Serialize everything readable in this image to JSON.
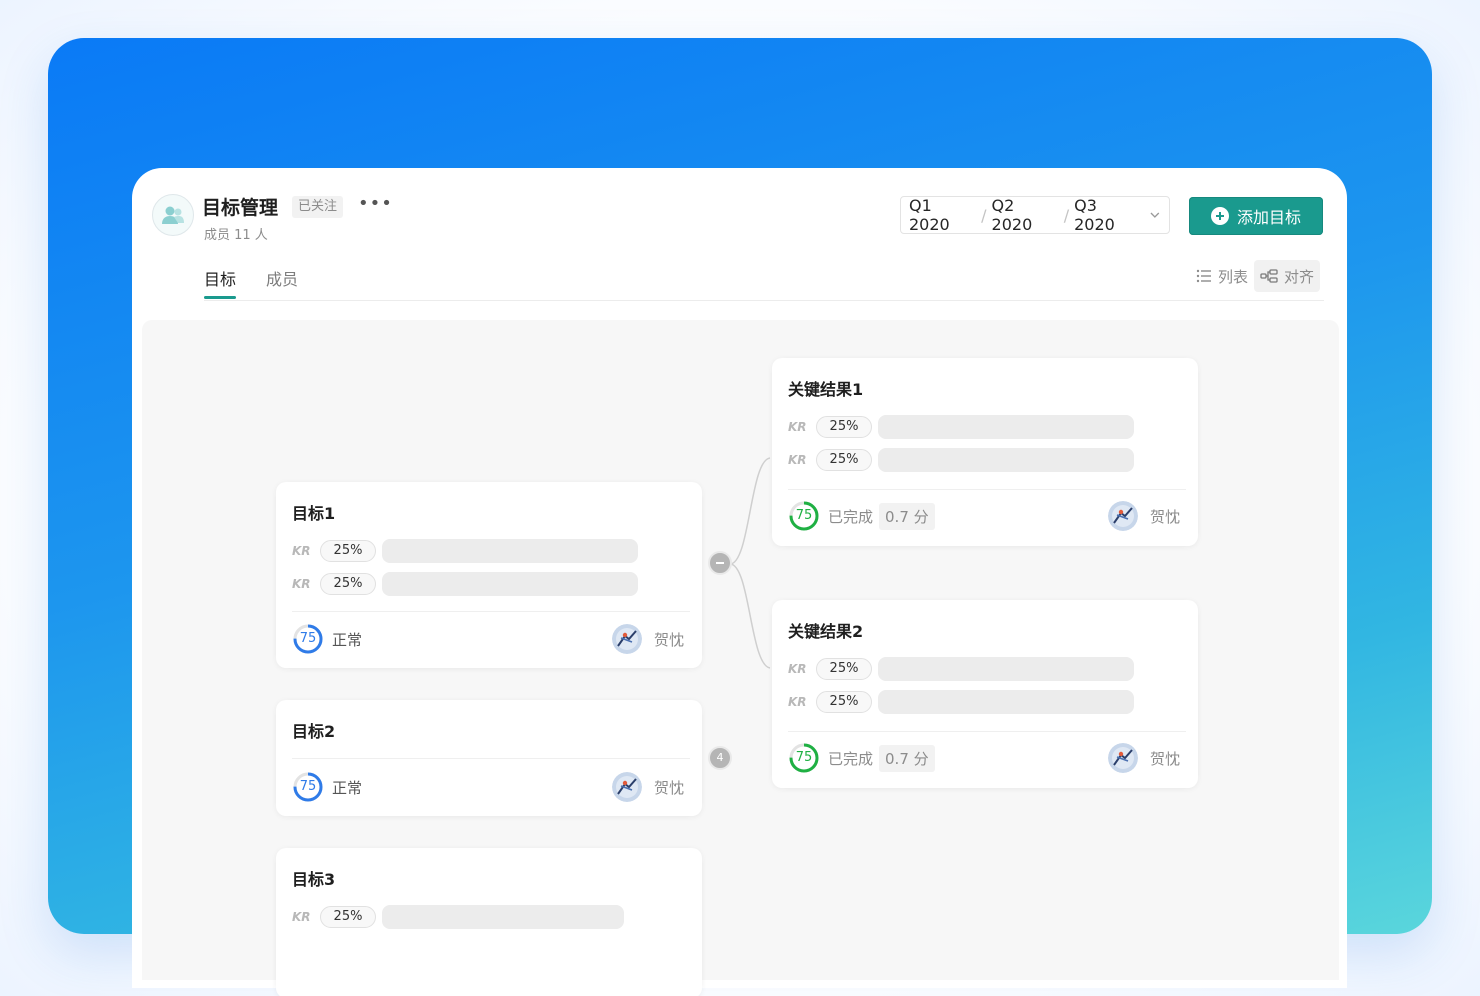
{
  "header": {
    "title": "目标管理",
    "follow_label": "已关注",
    "more_label": "•••",
    "members_label": "成员 11 人"
  },
  "quarters": [
    "Q1 2020",
    "Q2 2020",
    "Q3 2020"
  ],
  "add_button_label": "添加目标",
  "tabs": [
    {
      "label": "目标",
      "active": true
    },
    {
      "label": "成员",
      "active": false
    }
  ],
  "view_switch": {
    "list_label": "列表",
    "align_label": "对齐",
    "active": "align"
  },
  "colors": {
    "accent": "#1a9a8e",
    "score_blue": "#2f7be8",
    "score_green": "#1fb043"
  },
  "objectives": [
    {
      "title": "目标1",
      "krs": [
        {
          "tag": "KR",
          "pct": "25%"
        },
        {
          "tag": "KR",
          "pct": "25%"
        }
      ],
      "score": "75",
      "score_fraction": 0.75,
      "status": "正常",
      "owner": "贺忱"
    },
    {
      "title": "目标2",
      "krs": [],
      "score": "75",
      "score_fraction": 0.75,
      "status": "正常",
      "owner": "贺忱"
    },
    {
      "title": "目标3",
      "krs": [
        {
          "tag": "KR",
          "pct": "25%"
        }
      ]
    }
  ],
  "key_results": [
    {
      "title": "关键结果1",
      "krs": [
        {
          "tag": "KR",
          "pct": "25%"
        },
        {
          "tag": "KR",
          "pct": "25%"
        }
      ],
      "score": "75",
      "score_fraction": 0.75,
      "status": "已完成",
      "points": "0.7 分",
      "owner": "贺忱"
    },
    {
      "title": "关键结果2",
      "krs": [
        {
          "tag": "KR",
          "pct": "25%"
        },
        {
          "tag": "KR",
          "pct": "25%"
        }
      ],
      "score": "75",
      "score_fraction": 0.75,
      "status": "已完成",
      "points": "0.7 分",
      "owner": "贺忱"
    }
  ],
  "node_buttons": {
    "collapse_label": "",
    "objective2_children": "4"
  },
  "icons": {
    "team": "team-icon",
    "more": "more-icon",
    "chevron": "chevron-down-icon",
    "plus": "plus-circle-icon",
    "list": "list-icon",
    "align": "align-tree-icon",
    "avatar": "user-avatar"
  }
}
